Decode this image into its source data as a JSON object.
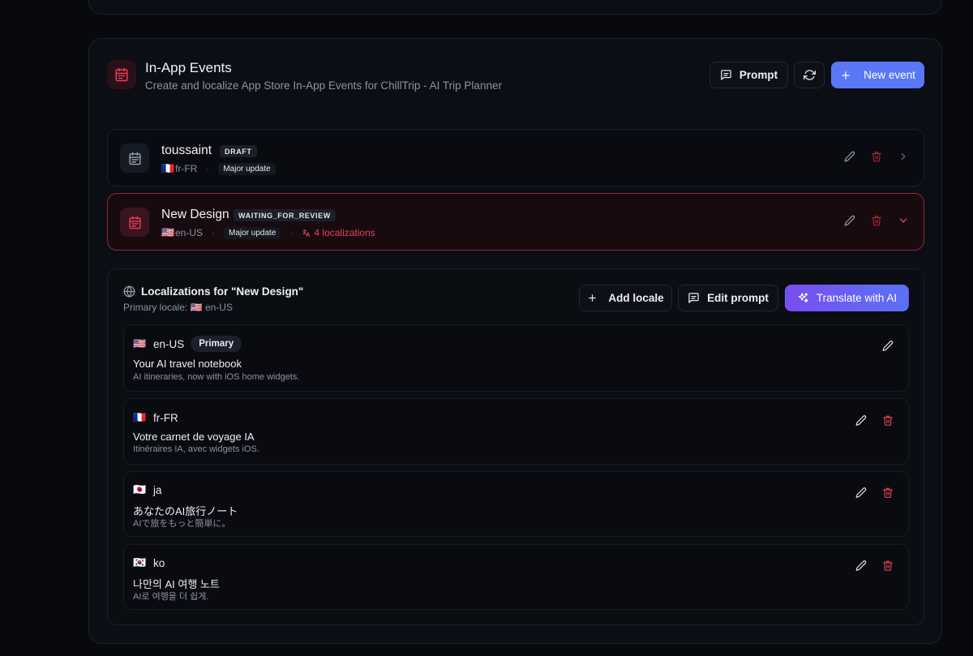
{
  "header": {
    "title": "In-App Events",
    "subtitle": "Create and localize App Store In-App Events for ChillTrip - AI Trip Planner",
    "buttons": {
      "prompt": "Prompt",
      "new_event": "New event"
    }
  },
  "events": [
    {
      "name": "toussaint",
      "status": "DRAFT",
      "flag": "🇫🇷",
      "locale": "fr-FR",
      "type": "Major update",
      "localizations": ""
    },
    {
      "name": "New Design",
      "status": "WAITING_FOR_REVIEW",
      "flag": "🇺🇸",
      "locale": "en-US",
      "type": "Major update",
      "localizations": "4 localizations"
    }
  ],
  "localizations_panel": {
    "title": "Localizations for \"New Design\"",
    "primary_label": "Primary locale: 🇺🇸 en-US",
    "buttons": {
      "add_locale": "Add locale",
      "edit_prompt": "Edit prompt",
      "translate": "Translate with AI"
    },
    "items": [
      {
        "flag": "🇺🇸",
        "code": "en-US",
        "badge": "Primary",
        "title": "Your AI travel notebook",
        "description": "AI itineraries, now with iOS home widgets."
      },
      {
        "flag": "🇫🇷",
        "code": "fr-FR",
        "badge": "",
        "title": "Votre carnet de voyage IA",
        "description": "Itinéraires IA, avec widgets iOS."
      },
      {
        "flag": "🇯🇵",
        "code": "ja",
        "badge": "",
        "title": "あなたのAI旅行ノート",
        "description": "AIで旅をもっと簡単に。"
      },
      {
        "flag": "🇰🇷",
        "code": "ko",
        "badge": "",
        "title": "나만의 AI 여행 노트",
        "description": "AI로 여행을 더 쉽게."
      }
    ]
  },
  "colors": {
    "accent": "#5a78f5",
    "danger": "#e8415b",
    "background": "#07090d"
  }
}
